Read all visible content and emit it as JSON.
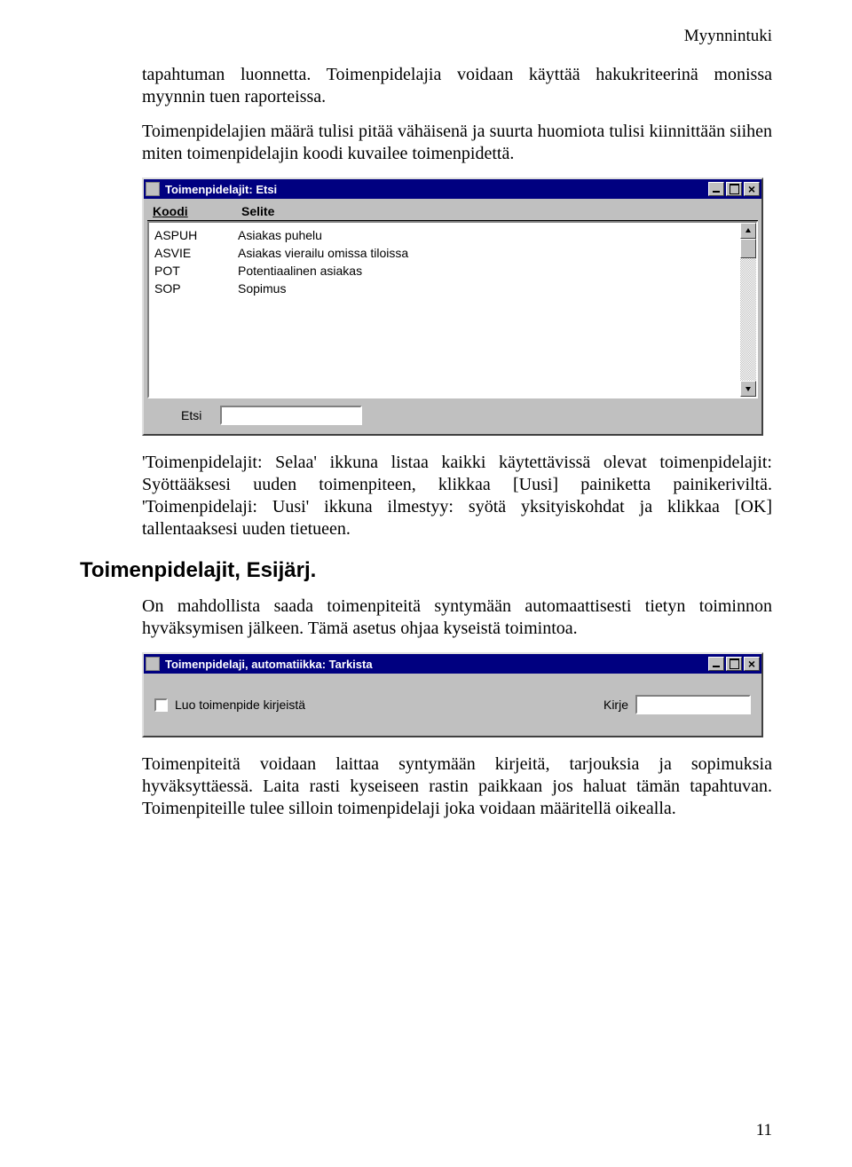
{
  "header_right": "Myynnintuki",
  "para1": "tapahtuman luonnetta. Toimenpidelajia voidaan käyttää hakukriteerinä monissa myynnin tuen raporteissa.",
  "para2": "Toimenpidelajien määrä tulisi pitää vähäisenä ja suurta huomiota tulisi kiinnittään siihen miten toimenpidelajin koodi kuvailee toimenpidettä.",
  "window1": {
    "title": "Toimenpidelajit: Etsi",
    "col_koodi": "Koodi",
    "col_selite": "Selite",
    "rows": [
      {
        "koodi": "ASPUH",
        "selite": "Asiakas puhelu"
      },
      {
        "koodi": "ASVIE",
        "selite": "Asiakas vierailu omissa tiloissa"
      },
      {
        "koodi": "POT",
        "selite": "Potentiaalinen asiakas"
      },
      {
        "koodi": "SOP",
        "selite": "Sopimus"
      }
    ],
    "etsi_label": "Etsi"
  },
  "para3": "'Toimenpidelajit: Selaa' ikkuna listaa kaikki käytettävissä olevat toimenpidelajit: Syöttääksesi uuden toimenpiteen, klikkaa [Uusi] painiketta painikeriviltä. 'Toimenpidelaji: Uusi' ikkuna ilmestyy: syötä yksityiskohdat ja klikkaa [OK] tallentaaksesi uuden tietueen.",
  "heading": "Toimenpidelajit, Esijärj.",
  "para4": "On mahdollista saada toimenpiteitä syntymään automaattisesti tietyn toiminnon hyväksymisen jälkeen. Tämä asetus ohjaa kyseistä toimintoa.",
  "window2": {
    "title": "Toimenpidelaji, automatiikka: Tarkista",
    "checkbox_label": "Luo toimenpide kirjeistä",
    "kirje_label": "Kirje"
  },
  "para5": "Toimenpiteitä voidaan laittaa syntymään kirjeitä, tarjouksia ja sopimuksia hyväksyttäessä. Laita rasti kyseiseen rastin paikkaan jos haluat tämän tapahtuvan. Toimenpiteille tulee silloin toimenpidelaji joka voidaan määritellä oikealla.",
  "page_number": "11"
}
